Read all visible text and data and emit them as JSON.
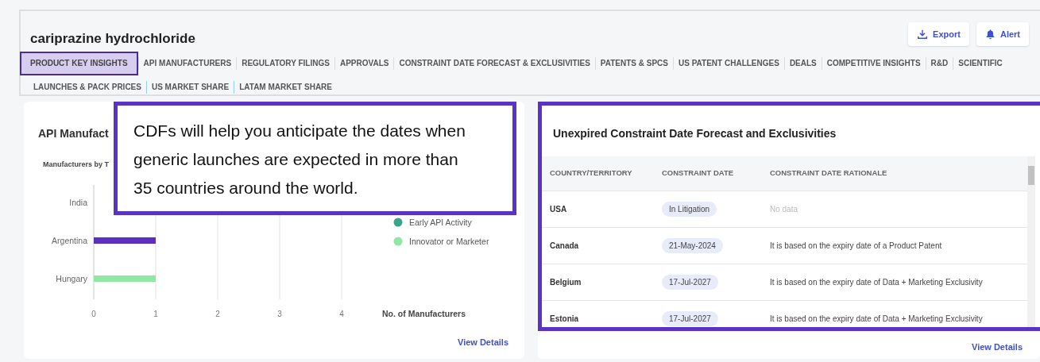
{
  "header": {
    "title": "cariprazine hydrochloride",
    "buttons": [
      {
        "kind": "export",
        "label": "Export"
      },
      {
        "kind": "alert",
        "label": "Alert"
      }
    ]
  },
  "tabs": [
    {
      "label": "PRODUCT KEY INSIGHTS",
      "selected": true
    },
    {
      "label": "API MANUFACTURERS",
      "selected": false
    },
    {
      "label": "REGULATORY FILINGS",
      "selected": false
    },
    {
      "label": "APPROVALS",
      "selected": false
    },
    {
      "label": "CONSTRAINT DATE FORECAST & EXCLUSIVITIES",
      "selected": false
    },
    {
      "label": "PATENTS & SPCS",
      "selected": false
    },
    {
      "label": "US PATENT CHALLENGES",
      "selected": false
    },
    {
      "label": "DEALS",
      "selected": false
    },
    {
      "label": "COMPETITIVE INSIGHTS",
      "selected": false
    },
    {
      "label": "R&D",
      "selected": false
    },
    {
      "label": "SCIENTIFIC",
      "selected": false
    },
    {
      "label": "LAUNCHES & PACK PRICES",
      "selected": false
    },
    {
      "label": "US MARKET SHARE",
      "selected": false
    },
    {
      "label": "LATAM MARKET SHARE",
      "selected": false
    }
  ],
  "left_card": {
    "title": "API Manufact",
    "subtitle": "Manufacturers by T",
    "link": "View Details",
    "chart_data": {
      "type": "bar",
      "grid": true,
      "orientation": "horizontal",
      "xlabel": "No. of Manufacturers",
      "categories": [
        "India",
        "Argentina",
        "Hungary"
      ],
      "xlim": [
        0,
        4
      ],
      "xticks": [
        0,
        1,
        2,
        3,
        4
      ],
      "series": [
        {
          "color": "#5b2fc0",
          "values": [
            null,
            1,
            0
          ]
        },
        {
          "name": "Early API Activity",
          "color": "#3aa58b",
          "values": [
            0,
            0,
            0
          ]
        },
        {
          "name": "Innovator or Marketer",
          "color": "#90e8a4",
          "values": [
            0,
            0,
            1
          ]
        }
      ]
    }
  },
  "callout": {
    "text": "CDFs will help you anticipate the dates when generic launches are expected in more than 35 countries around the world."
  },
  "right_card": {
    "title": "Unexpired Constraint Date Forecast and Exclusivities",
    "link": "View Details",
    "columns": [
      "COUNTRY/TERRITORY",
      "CONSTRAINT DATE",
      "CONSTRAINT DATE RATIONALE"
    ],
    "rows": [
      {
        "country": "USA",
        "date": "In Litigation",
        "rationale": "No data",
        "has_data": false
      },
      {
        "country": "Canada",
        "date": "21-May-2024",
        "rationale": "It is based on the expiry date of a Product Patent",
        "has_data": true
      },
      {
        "country": "Belgium",
        "date": "17-Jul-2027",
        "rationale": "It is based on the expiry date of Data + Marketing Exclusivity",
        "has_data": true
      },
      {
        "country": "Estonia",
        "date": "17-Jul-2027",
        "rationale": "It is based on the expiry date of Data + Marketing Exclusivity",
        "has_data": true
      }
    ]
  }
}
